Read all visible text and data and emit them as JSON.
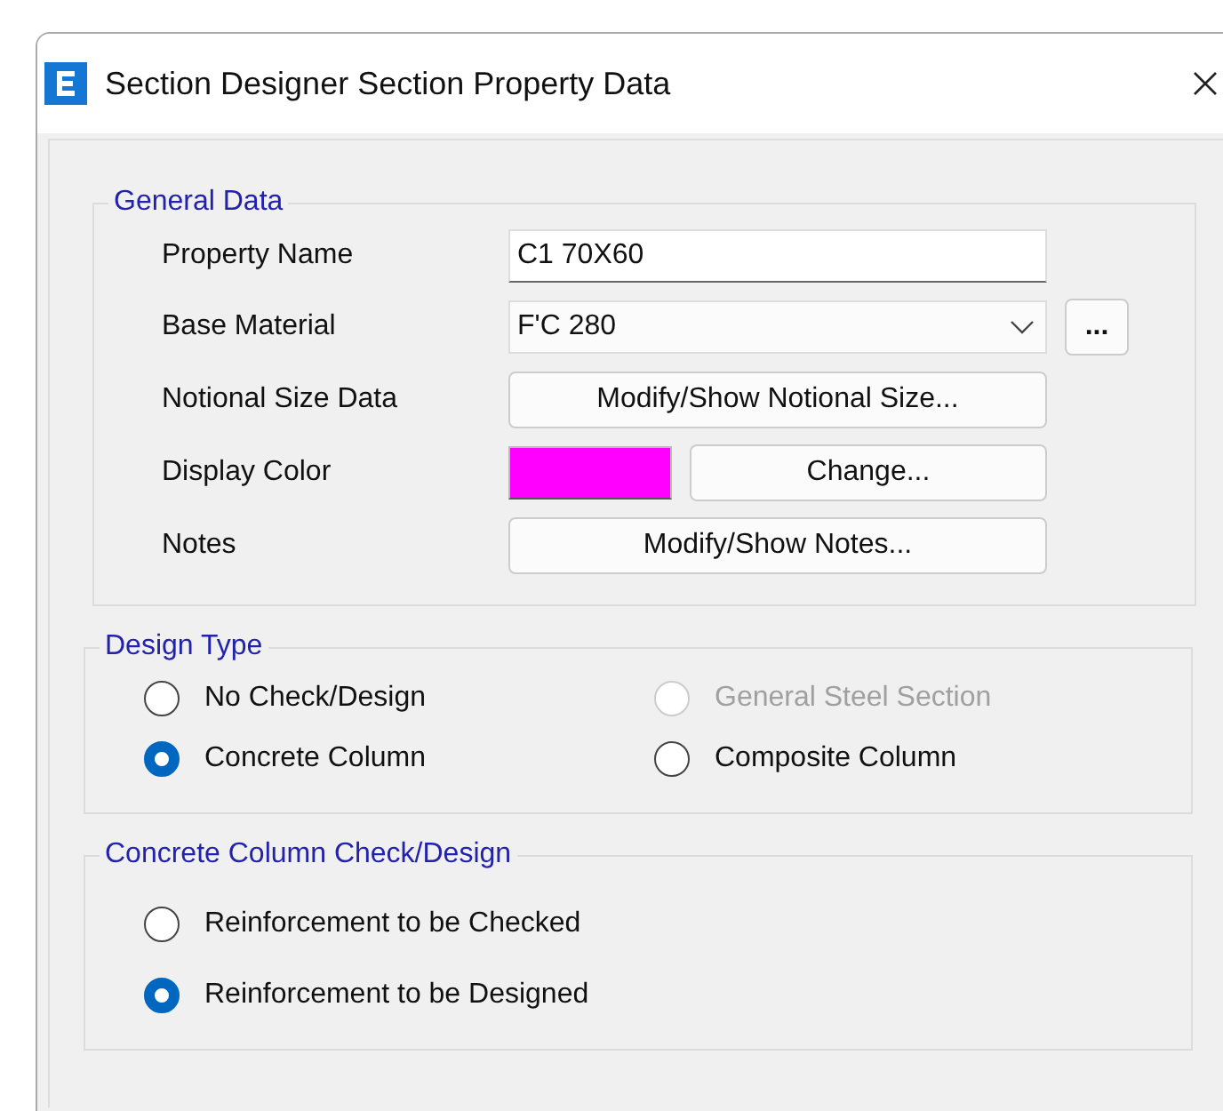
{
  "window": {
    "title": "Section Designer Section Property Data"
  },
  "general_data": {
    "title": "General Data",
    "rows": [
      {
        "kind": "field",
        "label": "Property Name",
        "value": "C1 70X60"
      },
      {
        "kind": "dropdown",
        "label": "Base Material",
        "value": "F'C 280",
        "more": "..."
      },
      {
        "kind": "button",
        "label": "Notional Size Data",
        "button": "Modify/Show Notional Size..."
      },
      {
        "kind": "color",
        "label": "Display Color",
        "color": "#ff00ff",
        "button": "Change..."
      },
      {
        "kind": "button",
        "label": "Notes",
        "button": "Modify/Show Notes..."
      }
    ]
  },
  "design_type": {
    "title": "Design Type",
    "options": [
      {
        "label": "No Check/Design",
        "selected": false,
        "disabled": false
      },
      {
        "label": "General Steel Section",
        "selected": false,
        "disabled": true
      },
      {
        "label": "Concrete Column",
        "selected": true,
        "disabled": false
      },
      {
        "label": "Composite Column",
        "selected": false,
        "disabled": false
      }
    ]
  },
  "concrete_column_check_design": {
    "title": "Concrete Column Check/Design",
    "options": [
      {
        "label": "Reinforcement to be Checked",
        "selected": false
      },
      {
        "label": "Reinforcement to be Designed",
        "selected": true
      }
    ]
  }
}
